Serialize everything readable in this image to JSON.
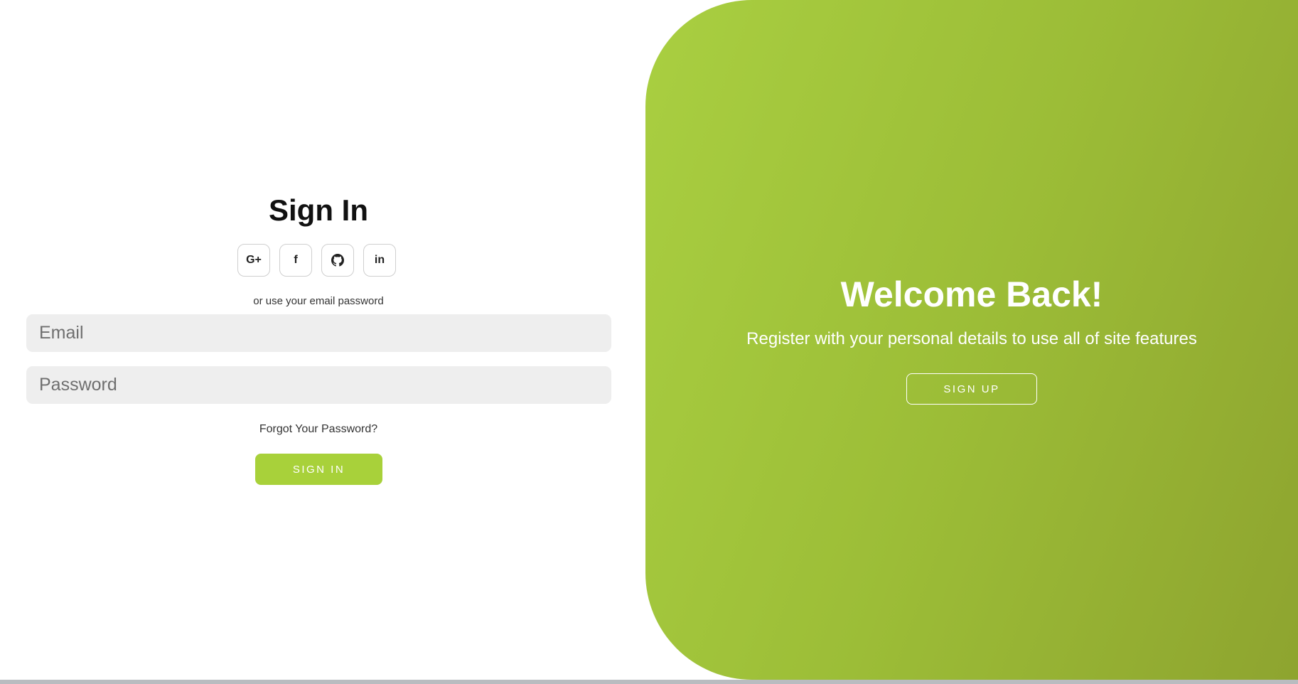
{
  "signin": {
    "title": "Sign In",
    "social": [
      {
        "icon": "google-plus-icon",
        "glyph": "G+"
      },
      {
        "icon": "facebook-icon",
        "glyph": "f"
      },
      {
        "icon": "github-icon",
        "glyph": ""
      },
      {
        "icon": "linkedin-icon",
        "glyph": "in"
      }
    ],
    "or_text": "or use your email password",
    "email_placeholder": "Email",
    "password_placeholder": "Password",
    "forgot_label": "Forgot Your Password?",
    "button_label": "SIGN IN"
  },
  "welcome": {
    "title": "Welcome Back!",
    "subtitle": "Register with your personal details to use all of site features",
    "button_label": "SIGN UP"
  },
  "colors": {
    "accent": "#a8d13a",
    "panel_start": "#a9cf41",
    "panel_end": "#8ea42f",
    "input_bg": "#eeeeee"
  }
}
